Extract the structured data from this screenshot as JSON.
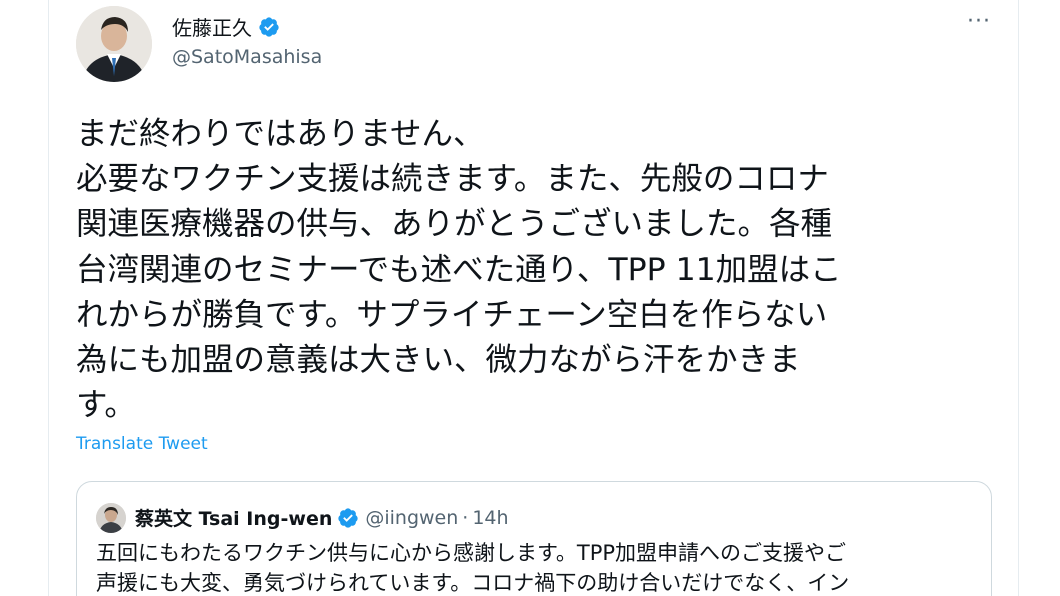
{
  "tweet": {
    "author_name": "佐藤正久",
    "author_handle": "@SatoMasahisa",
    "more_label": "···",
    "text_lines": [
      "まだ終わりではありません、",
      "必要なワクチン支援は続きます。また、先般のコロナ",
      "関連医療機器の供与、ありがとうございました。各種",
      "台湾関連のセミナーでも述べた通り、TPP 11加盟はこ",
      "れからが勝負です。サプライチェーン空白を作らない",
      "為にも加盟の意義は大きい、微力ながら汗をかきま",
      "す。"
    ],
    "translate_label": "Translate Tweet"
  },
  "quote": {
    "author_name": "蔡英文 Tsai Ing-wen",
    "author_handle": "@iingwen",
    "separator": "·",
    "time": "14h",
    "text_lines": [
      "五回にもわたるワクチン供与に心から感謝します。TPP加盟申請へのご支援やご",
      "声援にも大変、勇気づけられています。コロナ禍下の助け合いだけでなく、イン"
    ]
  },
  "colors": {
    "accent": "#1d9bf0",
    "text": "#0f1419",
    "secondary": "#536471",
    "border": "#cfd9de"
  },
  "icons": {
    "verified": "verified-badge-icon",
    "more": "more-options-icon"
  }
}
